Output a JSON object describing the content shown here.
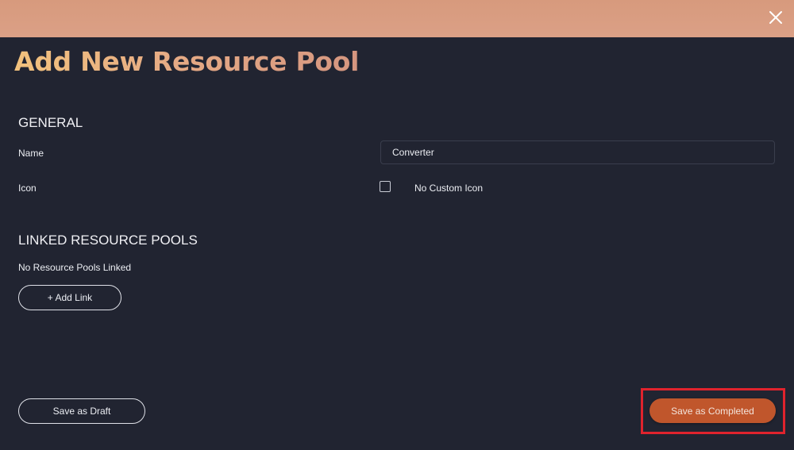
{
  "dialog": {
    "title": "Add New Resource Pool",
    "close_icon": "close-icon",
    "colors": {
      "header_bar": "#d99d80",
      "background": "#212431",
      "primary_button": "#c0562c",
      "highlight": "#e0232d"
    }
  },
  "general": {
    "heading": "GENERAL",
    "name_label": "Name",
    "name_value": "Converter",
    "icon_label": "Icon",
    "icon_checkbox_checked": false,
    "icon_checkbox_label": "No Custom Icon"
  },
  "linked": {
    "heading": "LINKED RESOURCE POOLS",
    "empty_text": "No Resource Pools Linked",
    "add_link_label": "+ Add Link"
  },
  "footer": {
    "save_draft_label": "Save as Draft",
    "save_completed_label": "Save as Completed"
  }
}
